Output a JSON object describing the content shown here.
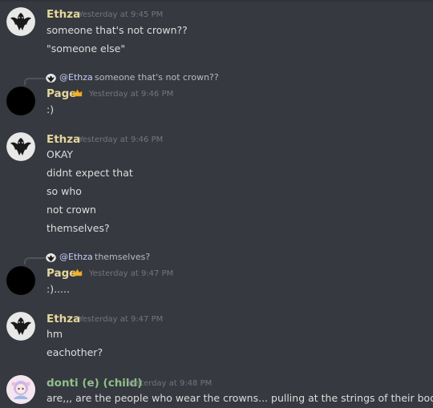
{
  "colors": {
    "background": "#36393f",
    "ethza_name": "#e5d79c",
    "page_name": "#e5d79c",
    "donti_name": "#8fc08a",
    "timestamp": "#72767d",
    "reply_mention": "#c9cdfb"
  },
  "messages": [
    {
      "author": "Ethza",
      "timestamp": "Yesterday at 9:45 PM",
      "lines": [
        "someone that's not crown??",
        "\"someone else\""
      ]
    },
    {
      "reply_to": {
        "author": "@Ethza",
        "text": "someone that's not crown??"
      },
      "author": "Page",
      "badge_icon": "crown-icon",
      "timestamp": "Yesterday at 9:46 PM",
      "lines": [
        ":)"
      ]
    },
    {
      "author": "Ethza",
      "timestamp": "Yesterday at 9:46 PM",
      "lines": [
        "OKAY",
        "didnt expect that",
        "so who",
        "not crown",
        "themselves?"
      ]
    },
    {
      "reply_to": {
        "author": "@Ethza",
        "text": "themselves?"
      },
      "author": "Page",
      "badge_icon": "crown-icon",
      "timestamp": "Yesterday at 9:47 PM",
      "lines": [
        ":)....."
      ]
    },
    {
      "author": "Ethza",
      "timestamp": "Yesterday at 9:47 PM",
      "lines": [
        "hm",
        "eachother?"
      ]
    },
    {
      "author": "donti (e) (child)",
      "timestamp": "Yesterday at 9:48 PM",
      "lines": [
        "are,,, are the people who wear the crowns... pulling at the strings of their body??"
      ]
    }
  ]
}
